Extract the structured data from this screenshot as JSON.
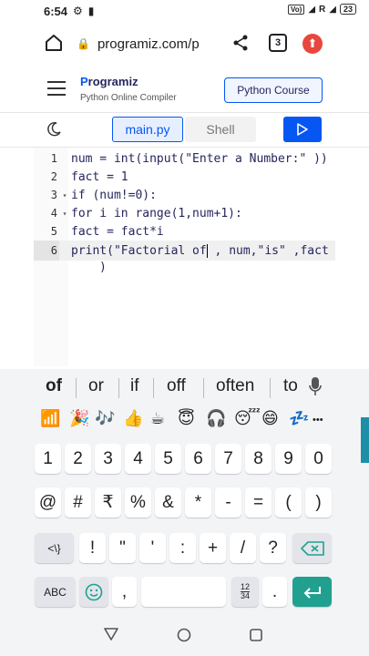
{
  "status_bar": {
    "time": "6:54",
    "indicators": [
      "settings-icon",
      "video-icon"
    ],
    "vo_label": "Vo)",
    "network_label": "R",
    "network_sub": "LTE",
    "battery": "23"
  },
  "browser": {
    "url": "programiz.com/p",
    "tab_count": "3"
  },
  "site": {
    "logo_letter": "P",
    "logo_rest": "rogramiz",
    "subtitle": "Python Online Compiler",
    "course_button": "Python Course"
  },
  "editor_toolbar": {
    "main_tab": "main.py",
    "shell_tab": "Shell"
  },
  "code": {
    "lines": [
      {
        "num": "1",
        "fold": "",
        "text": "num = int(input(\"Enter a Number:\" ))"
      },
      {
        "num": "2",
        "fold": "",
        "text": "fact = 1"
      },
      {
        "num": "3",
        "fold": "▾",
        "text": "if (num!=0):"
      },
      {
        "num": "4",
        "fold": "▾",
        "text": "for i in range(1,num+1):"
      },
      {
        "num": "5",
        "fold": "",
        "text": "fact = fact*i"
      },
      {
        "num": "6",
        "fold": "",
        "text_before": "print(\"Factorial of",
        "text_after": " , num,\"is\" ,fact"
      }
    ],
    "wrap": ")"
  },
  "keyboard": {
    "suggestions": [
      "of",
      "or",
      "if",
      "off",
      "often",
      "to"
    ],
    "emoji": [
      "📶",
      "🎉",
      "🎶",
      "👍",
      "☕",
      "😇",
      "🎧",
      "😴",
      "😄",
      "💤",
      "•••"
    ],
    "number_row": [
      "1",
      "2",
      "3",
      "4",
      "5",
      "6",
      "7",
      "8",
      "9",
      "0"
    ],
    "symbol_row": [
      "@",
      "#",
      "₹",
      "%",
      "&",
      "*",
      "-",
      "=",
      "(",
      ")"
    ],
    "third_row": [
      "!",
      "\"",
      "'",
      ":",
      "+",
      "/",
      "?"
    ],
    "shift_label": "<\\}",
    "abc_label": "ABC",
    "comma_label": ",",
    "period_label": ".",
    "numpad_top": "12",
    "numpad_bottom": "34"
  },
  "colors": {
    "brand_blue": "#0556f3",
    "enter_key": "#21a090",
    "update_badge": "#e8473d"
  }
}
